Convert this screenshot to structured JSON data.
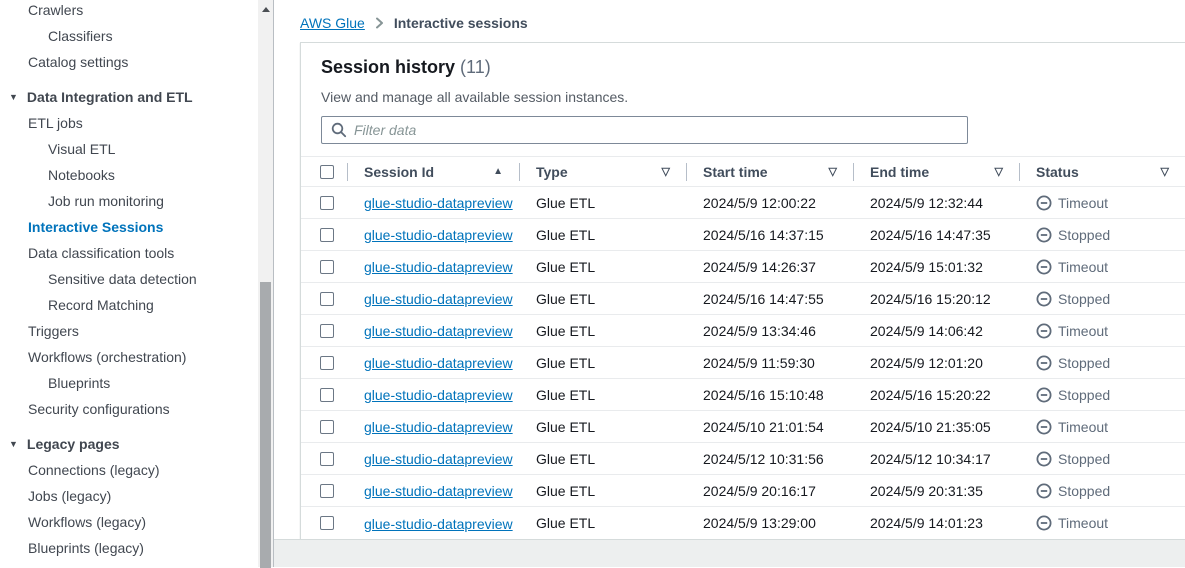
{
  "colors": {
    "link_blue": "#0073bb",
    "active_nav_blue": "#0073bb",
    "status_gray": "#5f6b7a",
    "text_dark": "#16191f",
    "header_text": "#414d5c"
  },
  "icons": {
    "search": "magnifier",
    "breadcrumb_separator": "chevron-right",
    "sort_ascending": "▲",
    "column_filter": "▽",
    "status": "minus-circle",
    "section_caret": "▼",
    "scroll_up": "▲"
  },
  "sidebar": {
    "items": [
      {
        "label": "Crawlers",
        "type": "item",
        "indent": 1
      },
      {
        "label": "Classifiers",
        "type": "item",
        "indent": 2
      },
      {
        "label": "Catalog settings",
        "type": "item",
        "indent": 1
      },
      {
        "label": "Data Integration and ETL",
        "type": "section",
        "indent": 0
      },
      {
        "label": "ETL jobs",
        "type": "item",
        "indent": 1
      },
      {
        "label": "Visual ETL",
        "type": "item",
        "indent": 2
      },
      {
        "label": "Notebooks",
        "type": "item",
        "indent": 2
      },
      {
        "label": "Job run monitoring",
        "type": "item",
        "indent": 2
      },
      {
        "label": "Interactive Sessions",
        "type": "item",
        "indent": 1,
        "active": true
      },
      {
        "label": "Data classification tools",
        "type": "item",
        "indent": 1
      },
      {
        "label": "Sensitive data detection",
        "type": "item",
        "indent": 2
      },
      {
        "label": "Record Matching",
        "type": "item",
        "indent": 2
      },
      {
        "label": "Triggers",
        "type": "item",
        "indent": 1
      },
      {
        "label": "Workflows (orchestration)",
        "type": "item",
        "indent": 1
      },
      {
        "label": "Blueprints",
        "type": "item",
        "indent": 2
      },
      {
        "label": "Security configurations",
        "type": "item",
        "indent": 1
      },
      {
        "label": "Legacy pages",
        "type": "section",
        "indent": 0
      },
      {
        "label": "Connections (legacy)",
        "type": "item",
        "indent": 1
      },
      {
        "label": "Jobs (legacy)",
        "type": "item",
        "indent": 1
      },
      {
        "label": "Workflows (legacy)",
        "type": "item",
        "indent": 1
      },
      {
        "label": "Blueprints (legacy)",
        "type": "item",
        "indent": 1
      }
    ]
  },
  "breadcrumb": {
    "items": [
      {
        "label": "AWS Glue",
        "link": true
      },
      {
        "label": "Interactive sessions",
        "current": true
      }
    ]
  },
  "panel": {
    "title": "Session history",
    "count": "(11)",
    "description": "View and manage all available session instances.",
    "filter_placeholder": "Filter data"
  },
  "table": {
    "columns": [
      "Session Id",
      "Type",
      "Start time",
      "End time",
      "Status"
    ],
    "sort": {
      "column": "Session Id",
      "direction": "ascending"
    },
    "rows": [
      {
        "session_id": "glue-studio-datapreview",
        "type": "Glue ETL",
        "start_time": "2024/5/9 12:00:22",
        "end_time": "2024/5/9 12:32:44",
        "status": "Timeout"
      },
      {
        "session_id": "glue-studio-datapreview",
        "type": "Glue ETL",
        "start_time": "2024/5/16 14:37:15",
        "end_time": "2024/5/16 14:47:35",
        "status": "Stopped"
      },
      {
        "session_id": "glue-studio-datapreview",
        "type": "Glue ETL",
        "start_time": "2024/5/9 14:26:37",
        "end_time": "2024/5/9 15:01:32",
        "status": "Timeout"
      },
      {
        "session_id": "glue-studio-datapreview",
        "type": "Glue ETL",
        "start_time": "2024/5/16 14:47:55",
        "end_time": "2024/5/16 15:20:12",
        "status": "Stopped"
      },
      {
        "session_id": "glue-studio-datapreview",
        "type": "Glue ETL",
        "start_time": "2024/5/9 13:34:46",
        "end_time": "2024/5/9 14:06:42",
        "status": "Timeout"
      },
      {
        "session_id": "glue-studio-datapreview",
        "type": "Glue ETL",
        "start_time": "2024/5/9 11:59:30",
        "end_time": "2024/5/9 12:01:20",
        "status": "Stopped"
      },
      {
        "session_id": "glue-studio-datapreview",
        "type": "Glue ETL",
        "start_time": "2024/5/16 15:10:48",
        "end_time": "2024/5/16 15:20:22",
        "status": "Stopped"
      },
      {
        "session_id": "glue-studio-datapreview",
        "type": "Glue ETL",
        "start_time": "2024/5/10 21:01:54",
        "end_time": "2024/5/10 21:35:05",
        "status": "Timeout"
      },
      {
        "session_id": "glue-studio-datapreview",
        "type": "Glue ETL",
        "start_time": "2024/5/12 10:31:56",
        "end_time": "2024/5/12 10:34:17",
        "status": "Stopped"
      },
      {
        "session_id": "glue-studio-datapreview",
        "type": "Glue ETL",
        "start_time": "2024/5/9 20:16:17",
        "end_time": "2024/5/9 20:31:35",
        "status": "Stopped"
      },
      {
        "session_id": "glue-studio-datapreview",
        "type": "Glue ETL",
        "start_time": "2024/5/9 13:29:00",
        "end_time": "2024/5/9 14:01:23",
        "status": "Timeout"
      }
    ]
  }
}
